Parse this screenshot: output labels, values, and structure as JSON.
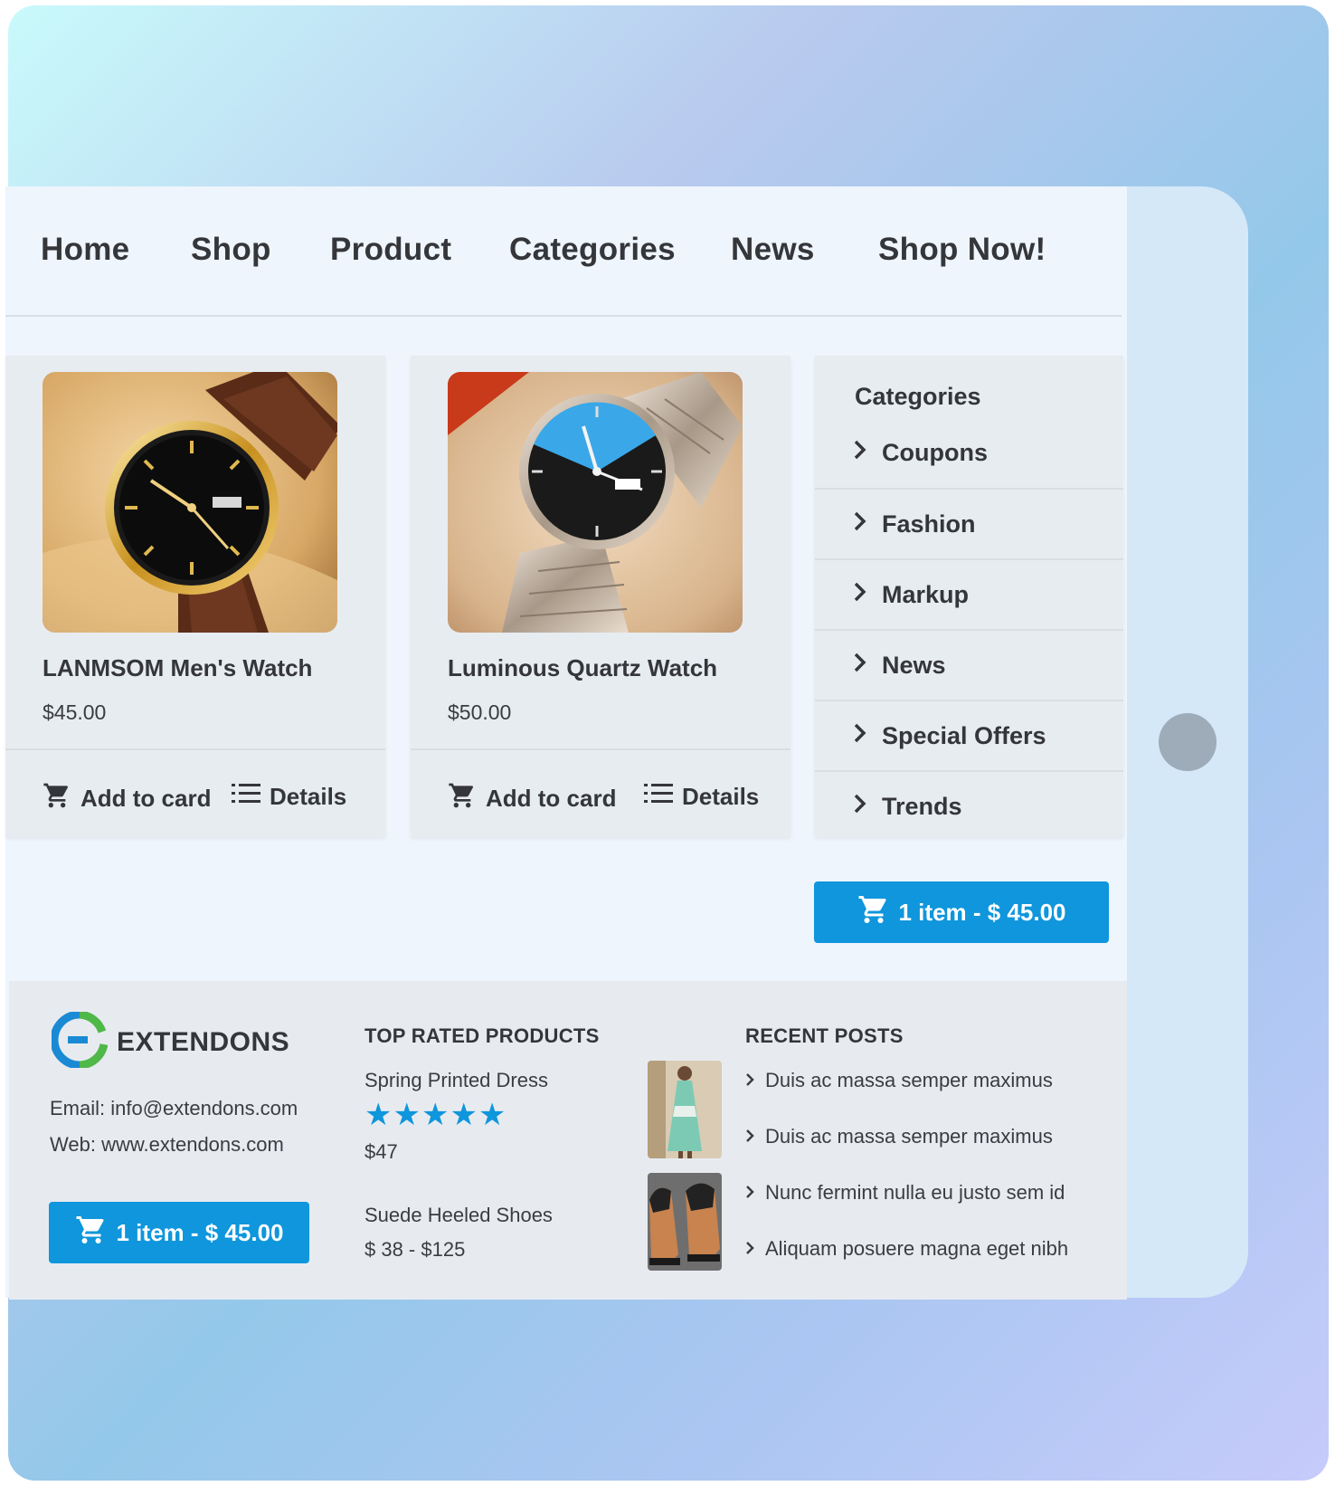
{
  "nav": {
    "items": [
      "Home",
      "Shop",
      "Product",
      "Categories",
      "News",
      "Shop Now!"
    ]
  },
  "products": [
    {
      "title": "LANMSOM Men's Watch",
      "price": "$45.00",
      "add_label": "Add to card",
      "details_label": "Details",
      "image_icon": "watch-brown-strap"
    },
    {
      "title": "Luminous Quartz Watch",
      "price": "$50.00",
      "add_label": "Add to card",
      "details_label": "Details",
      "image_icon": "watch-steel-band"
    }
  ],
  "categories": {
    "heading": "Categories",
    "items": [
      "Coupons",
      "Fashion",
      "Markup",
      "News",
      "Special Offers",
      "Trends"
    ]
  },
  "cart": {
    "label": "1 item - $ 45.00",
    "color": "#0f96dc"
  },
  "footer": {
    "brand": "EXTENDONS",
    "email": "Email: info@extendons.com",
    "web": "Web: www.extendons.com",
    "cart_label": "1 item - $ 45.00",
    "top_rated": {
      "heading": "TOP RATED PRODUCTS",
      "items": [
        {
          "name": "Spring Printed Dress",
          "stars": "★★★★★",
          "rating": 5,
          "price": "$47"
        },
        {
          "name": "Suede Heeled Shoes",
          "price": "$ 38 - $125"
        }
      ]
    },
    "recent_posts": {
      "heading": "RECENT POSTS",
      "items": [
        "Duis ac massa semper maximus",
        "Duis ac massa semper maximus",
        "Nunc fermint nulla eu justo sem id",
        "Aliquam posuere magna eget nibh"
      ]
    }
  }
}
